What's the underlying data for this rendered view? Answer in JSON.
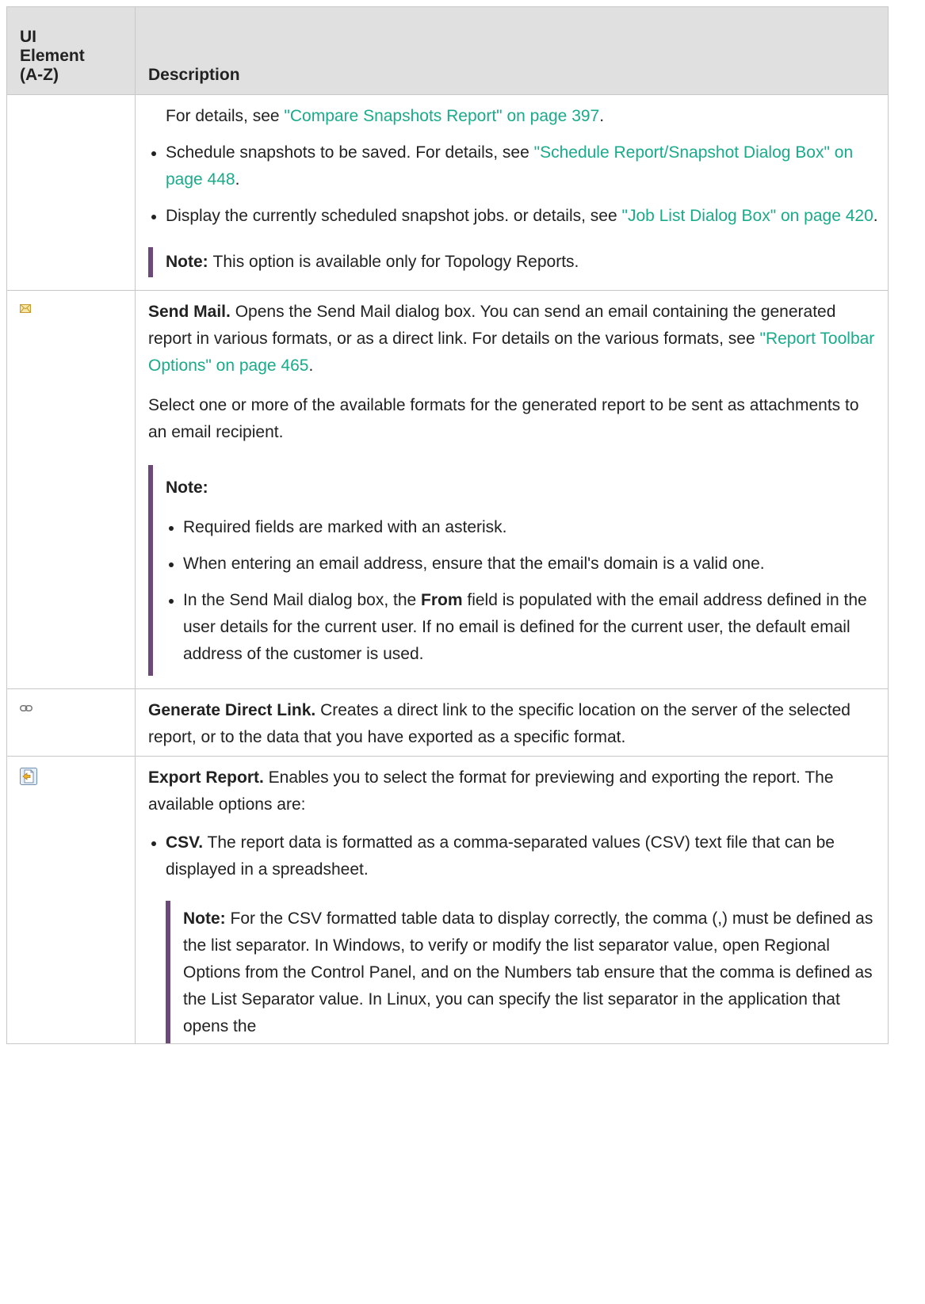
{
  "header": {
    "col1": [
      "UI",
      "Element",
      "(A-Z)"
    ],
    "col2": "Description"
  },
  "row1": {
    "cont_text": "For details, see ",
    "cont_link": "\"Compare Snapshots Report\" on page 397",
    "cont_end": ".",
    "bullets": [
      {
        "text": "Schedule snapshots to be saved. For details, see ",
        "link": "\"Schedule Report/Snapshot Dialog Box\" on page 448",
        "end": "."
      },
      {
        "text": "Display the currently scheduled snapshot jobs. or details, see ",
        "link": "\"Job List Dialog Box\" on page 420",
        "end": "."
      }
    ],
    "note_label": "Note:",
    "note_text": "This option is available only for Topology Reports."
  },
  "row2": {
    "icon": "envelope-icon",
    "title": "Send Mail.",
    "text1": " Opens the Send Mail dialog box. You can send an email containing the generated report in various formats, or as a direct link. For details on the various formats, see ",
    "link1": "\"Report Toolbar Options\" on page 465",
    "end1": ".",
    "para2": "Select one or more of the available formats for the generated report to be sent as attachments to an email recipient.",
    "note_label": "Note:",
    "note_bullets": [
      "Required fields are marked with an asterisk.",
      "When entering an email address, ensure that the email's domain is a valid one."
    ],
    "note_b3_pre": "In the Send Mail dialog box, the ",
    "note_b3_bold": "From",
    "note_b3_post": " field is populated with the email address defined in the user details for the current user. If no email is defined for the current user, the default email address of the customer is used."
  },
  "row3": {
    "icon": "link-icon",
    "title": "Generate Direct Link.",
    "text": " Creates a direct link to the specific location on the server of the selected report, or to the data that you have exported as a specific format."
  },
  "row4": {
    "icon": "export-icon",
    "title": "Export Report.",
    "text": " Enables you to select the format for previewing and exporting the report. The available options are:",
    "bullet_title": "CSV.",
    "bullet_text": " The report data is formatted as a comma-separated values (CSV) text file that can be displayed in a spreadsheet.",
    "note_label": "Note:",
    "note_text": " For the CSV formatted table data to display correctly, the comma (,) must be defined as the list separator. In Windows, to verify or modify the list separator value, open Regional Options from the Control Panel, and on the Numbers tab ensure that the comma is defined as the List Separator value. In Linux, you can specify the list separator in the application that opens the"
  }
}
